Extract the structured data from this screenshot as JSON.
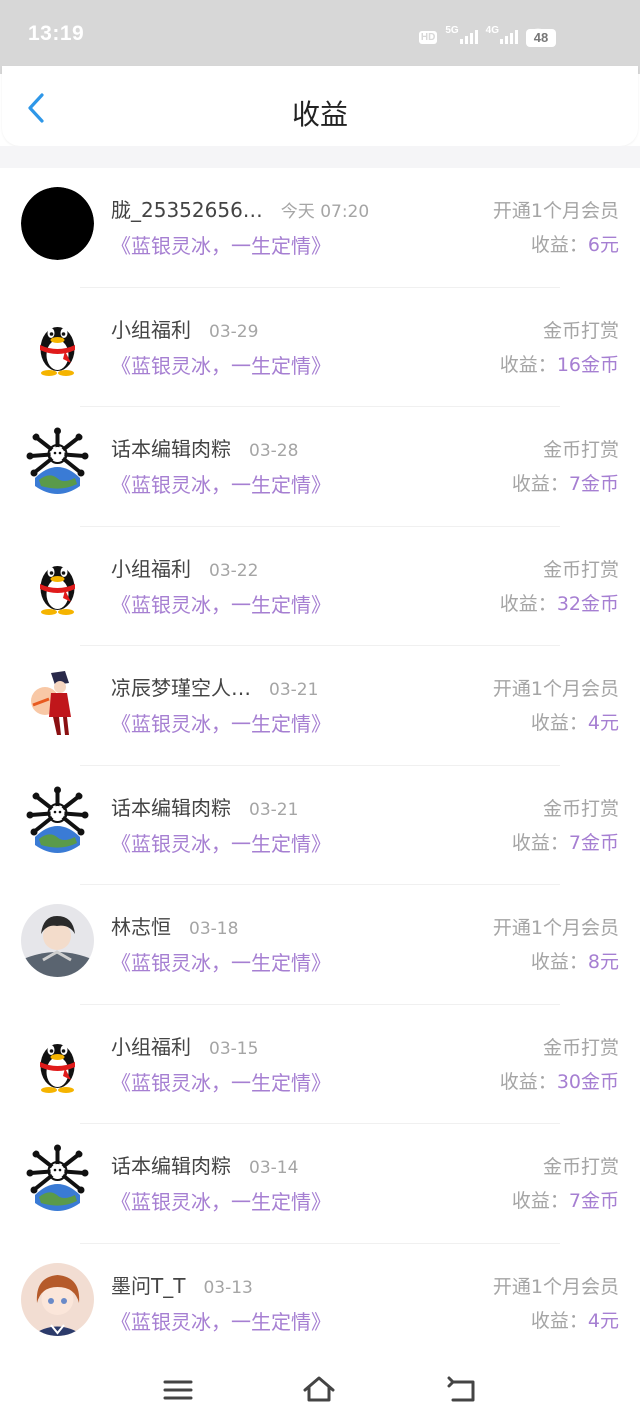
{
  "status_bar": {
    "time": "13:19",
    "hd": "HD",
    "signal_5g": "5G",
    "signal_4g": "4G",
    "battery": "48"
  },
  "header": {
    "back_icon": "chevron-left-icon",
    "title": "收益"
  },
  "colors": {
    "accent_purple": "#a67fd2",
    "back_blue": "#2e97e8",
    "muted_gray": "#a5a5a5"
  },
  "records": [
    {
      "avatar": "black-circle",
      "name": "胧_25352656…",
      "date": "今天 07:20",
      "book": "《蓝银灵冰，一生定情》",
      "type": "开通1个月会员",
      "earn_label": "收益：",
      "earn_amount": "6元"
    },
    {
      "avatar": "penguin",
      "name": "小组福利",
      "date": "03-29",
      "book": "《蓝银灵冰，一生定情》",
      "type": "金币打赏",
      "earn_label": "收益：",
      "earn_amount": "16金币"
    },
    {
      "avatar": "earth-skull",
      "name": "话本编辑肉粽",
      "date": "03-28",
      "book": "《蓝银灵冰，一生定情》",
      "type": "金币打赏",
      "earn_label": "收益：",
      "earn_amount": "7金币"
    },
    {
      "avatar": "penguin",
      "name": "小组福利",
      "date": "03-22",
      "book": "《蓝银灵冰，一生定情》",
      "type": "金币打赏",
      "earn_label": "收益：",
      "earn_amount": "32金币"
    },
    {
      "avatar": "anime-red",
      "name": "凉辰梦瑾空人…",
      "date": "03-21",
      "book": "《蓝银灵冰，一生定情》",
      "type": "开通1个月会员",
      "earn_label": "收益：",
      "earn_amount": "4元"
    },
    {
      "avatar": "earth-skull",
      "name": "话本编辑肉粽",
      "date": "03-21",
      "book": "《蓝银灵冰，一生定情》",
      "type": "金币打赏",
      "earn_label": "收益：",
      "earn_amount": "7金币"
    },
    {
      "avatar": "anime-boy",
      "name": "林志恒",
      "date": "03-18",
      "book": "《蓝银灵冰，一生定情》",
      "type": "开通1个月会员",
      "earn_label": "收益：",
      "earn_amount": "8元"
    },
    {
      "avatar": "penguin",
      "name": "小组福利",
      "date": "03-15",
      "book": "《蓝银灵冰，一生定情》",
      "type": "金币打赏",
      "earn_label": "收益：",
      "earn_amount": "30金币"
    },
    {
      "avatar": "earth-skull",
      "name": "话本编辑肉粽",
      "date": "03-14",
      "book": "《蓝银灵冰，一生定情》",
      "type": "金币打赏",
      "earn_label": "收益：",
      "earn_amount": "7金币"
    },
    {
      "avatar": "anime-girl",
      "name": "墨问T_T",
      "date": "03-13",
      "book": "《蓝银灵冰，一生定情》",
      "type": "开通1个月会员",
      "earn_label": "收益：",
      "earn_amount": "4元"
    }
  ],
  "nav_bar": {
    "menu_icon": "menu-icon",
    "home_icon": "home-icon",
    "back_icon": "back-icon"
  }
}
